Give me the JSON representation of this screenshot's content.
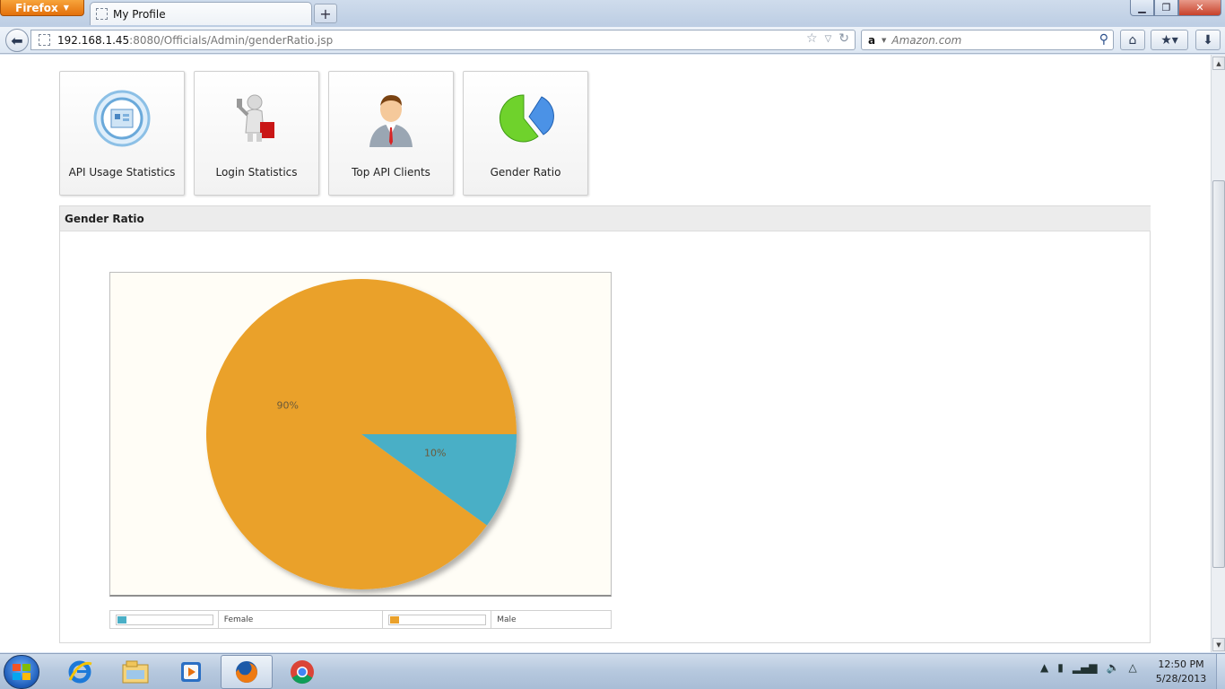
{
  "browser": {
    "menu_button": "Firefox",
    "tab_title": "My Profile",
    "url_host": "192.168.1.45",
    "url_rest": ":8080/Officials/Admin/genderRatio.jsp",
    "search_engine": "a",
    "search_placeholder": "Amazon.com"
  },
  "tiles": [
    {
      "label": "API Usage Statistics",
      "icon": "api-usage-icon"
    },
    {
      "label": "Login Statistics",
      "icon": "login-statistics-icon"
    },
    {
      "label": "Top API Clients",
      "icon": "top-clients-icon"
    },
    {
      "label": "Gender Ratio",
      "icon": "gender-ratio-icon"
    }
  ],
  "panel": {
    "title": "Gender Ratio"
  },
  "chart_data": {
    "type": "pie",
    "categories": [
      "Female",
      "Male"
    ],
    "values": [
      10,
      90
    ],
    "labels": [
      "10%",
      "90%"
    ],
    "colors": [
      "#4aafc6",
      "#eaa12b"
    ],
    "legend": "bottom"
  },
  "taskbar": {
    "time": "12:50 PM",
    "date": "5/28/2013",
    "apps": [
      "internet-explorer-icon",
      "windows-explorer-icon",
      "media-player-icon",
      "firefox-icon",
      "chrome-icon"
    ]
  }
}
